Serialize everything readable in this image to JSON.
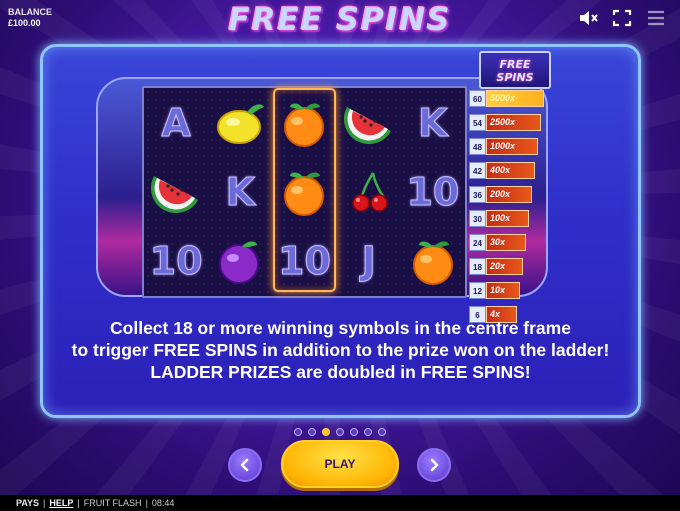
{
  "balance": {
    "label": "BALANCE",
    "value": "£100.00"
  },
  "header": {
    "title": "FREE SPINS"
  },
  "ladder": {
    "title_line1": "FREE",
    "title_line2": "SPINS",
    "rungs": [
      {
        "count": "60",
        "prize": "5000x"
      },
      {
        "count": "54",
        "prize": "2500x"
      },
      {
        "count": "48",
        "prize": "1000x"
      },
      {
        "count": "42",
        "prize": "400x"
      },
      {
        "count": "36",
        "prize": "200x"
      },
      {
        "count": "30",
        "prize": "100x"
      },
      {
        "count": "24",
        "prize": "30x"
      },
      {
        "count": "18",
        "prize": "20x"
      },
      {
        "count": "12",
        "prize": "10x"
      },
      {
        "count": "6",
        "prize": "4x"
      }
    ]
  },
  "reels": {
    "row1": [
      "A",
      "lemon",
      "orange",
      "watermelon",
      "K"
    ],
    "row2": [
      "watermelon",
      "K",
      "orange",
      "cherries",
      "10"
    ],
    "row3": [
      "10",
      "plum",
      "10",
      "J",
      "orange"
    ]
  },
  "description": {
    "line1": "Collect 18 or more winning symbols in the centre frame",
    "line2": "to trigger FREE SPINS in addition to the prize won on the ladder!",
    "line3": "LADDER PRIZES are doubled in FREE SPINS!"
  },
  "pagination": {
    "pages": 7,
    "current": 3
  },
  "buttons": {
    "play": "PLAY",
    "prev_icon": "chevron-left-icon",
    "next_icon": "chevron-right-icon"
  },
  "footer": {
    "pays": "PAYS",
    "sep": "|",
    "help": "HELP",
    "game": "FRUIT FLASH",
    "time": "08:44"
  },
  "colors": {
    "accent": "#ffc21a",
    "frame": "#2f2fc9",
    "prize": "#e8581a"
  }
}
